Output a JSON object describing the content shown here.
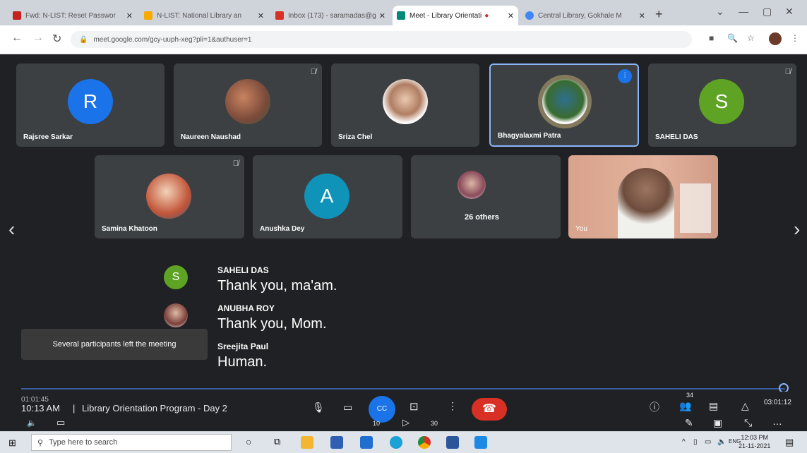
{
  "browser": {
    "tabs": [
      {
        "title": "Fwd: N-LIST: Reset Passwor",
        "favicon_color": "#c5221f"
      },
      {
        "title": "N-LIST: National Library an",
        "favicon_color": "#f9ab00"
      },
      {
        "title": "Inbox (173) - saramadas@g",
        "favicon_color": "#d93025"
      },
      {
        "title": "Meet - Library Orientati",
        "favicon_color": "#00897b",
        "active": true
      },
      {
        "title": "Central Library, Gokhale M",
        "favicon_color": "#4285f4"
      }
    ],
    "new_tab": "+",
    "window_controls": {
      "minimize": "—",
      "maximize": "▢",
      "close": "✕"
    },
    "url": "meet.google.com/gcy-uuph-xeg?pli=1&authuser=1"
  },
  "participants_row1": [
    {
      "name": "Rajsree Sarkar",
      "avatar_type": "letter",
      "letter": "R",
      "color": "#1a73e8"
    },
    {
      "name": "Naureen Naushad",
      "avatar_type": "photo",
      "muted": true
    },
    {
      "name": "Sriza Chel",
      "avatar_type": "photo"
    },
    {
      "name": "Bhagyalaxmi Patra",
      "avatar_type": "photo",
      "speaking": true
    },
    {
      "name": "SAHELI DAS",
      "avatar_type": "letter",
      "letter": "S",
      "color": "#5fa324",
      "muted": true
    }
  ],
  "participants_row2": [
    {
      "name": "Samina Khatoon",
      "avatar_type": "photo",
      "muted": true
    },
    {
      "name": "Anushka Dey",
      "avatar_type": "letter",
      "letter": "A",
      "color": "#0f93b8"
    },
    {
      "name": "26 others",
      "avatar_type": "photo"
    },
    {
      "name": "You",
      "avatar_type": "self-video"
    }
  ],
  "captions": [
    {
      "speaker": "SAHELI DAS",
      "text": "Thank you, ma'am.",
      "avatar_letter": "S",
      "color": "#5fa324"
    },
    {
      "speaker": "ANUBHA ROY",
      "text": "Thank you, Mom.",
      "avatar_type": "photo"
    },
    {
      "speaker": "Sreejita Paul",
      "text": "Human."
    }
  ],
  "toast": "Several participants left the meeting",
  "meeting": {
    "recording_time": "01:01:45",
    "time": "10:13 AM",
    "separator": "|",
    "title": "Library Orientation Program - Day 2",
    "participant_count": "34",
    "elapsed": "03:01:12",
    "progress": 0.99
  },
  "controls": {
    "mic_icon": "mic-icon",
    "camera_icon": "camera-icon",
    "cc_label": "CC",
    "present_icon": "present-icon",
    "more_icon": "more-vert-icon",
    "end_call_icon": "end-call-icon",
    "rewind_label": "10",
    "forward_label": "30"
  },
  "taskbar": {
    "search_placeholder": "Type here to search",
    "tray_lang": "ENG",
    "clock_time": "12:03 PM",
    "clock_date": "21-11-2021"
  }
}
